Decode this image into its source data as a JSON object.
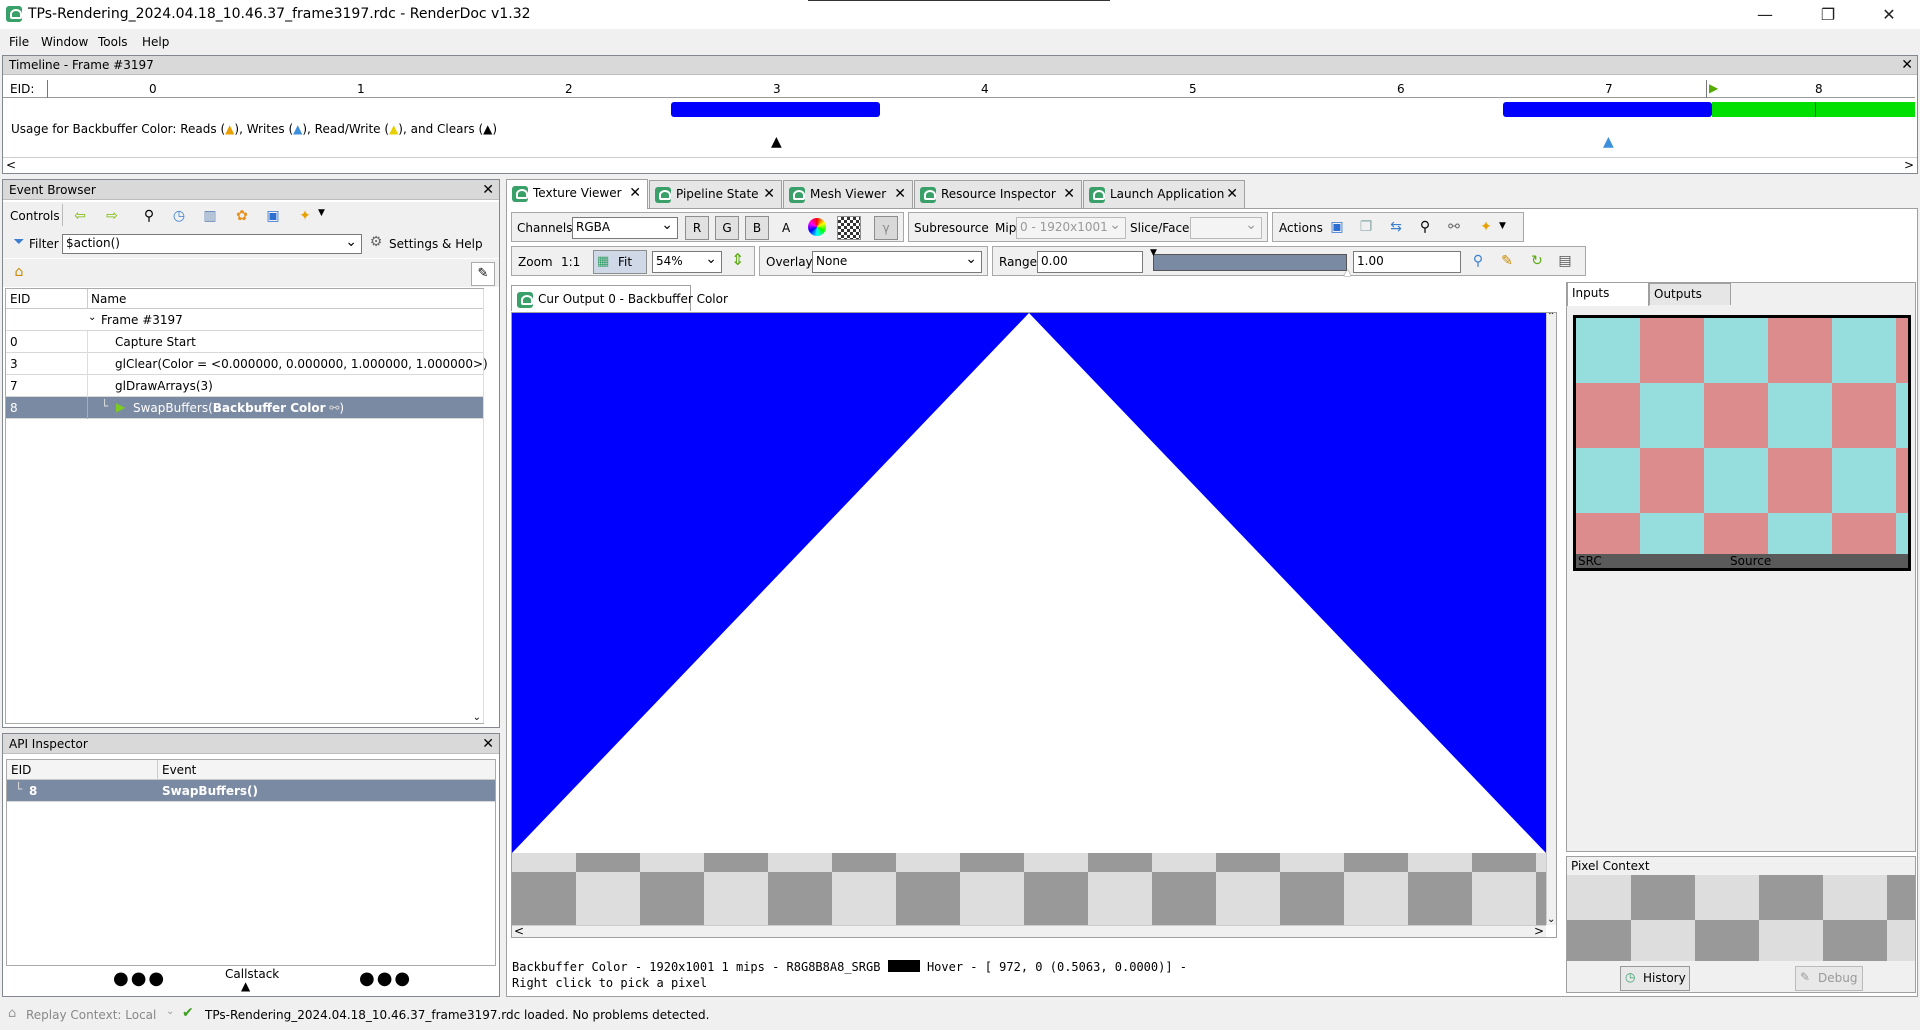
{
  "window": {
    "title": "TPs-Rendering_2024.04.18_10.46.37_frame3197.rdc - RenderDoc v1.32",
    "minimize": "—",
    "restore": "❐",
    "close": "✕"
  },
  "menu": [
    "File",
    "Window",
    "Tools",
    "Help"
  ],
  "timeline": {
    "title": "Timeline - Frame #3197",
    "eid_label": "EID:",
    "ticks": [
      "0",
      "1",
      "2",
      "3",
      "4",
      "5",
      "6",
      "7",
      "8"
    ],
    "usage_text": "Usage for Backbuffer Color: Reads (",
    "usage_writes": "), Writes (",
    "usage_rw": "), Read/Write (",
    "usage_clears": "), and Clears (",
    "usage_end": ")"
  },
  "event_browser": {
    "title": "Event Browser",
    "controls_label": "Controls",
    "filter_label": "Filter",
    "filter_value": "$action()",
    "settings_label": "Settings & Help",
    "columns": [
      "EID",
      "Name"
    ],
    "rows": [
      {
        "eid": "",
        "name": "Frame #3197"
      },
      {
        "eid": "0",
        "name": "Capture Start"
      },
      {
        "eid": "3",
        "name": "glClear(Color = <0.000000, 0.000000, 1.000000, 1.000000>)"
      },
      {
        "eid": "7",
        "name": "glDrawArrays(3)"
      },
      {
        "eid": "8",
        "name": "SwapBuffers(",
        "bold": "Backbuffer Color",
        "end": ")"
      }
    ]
  },
  "api_inspector": {
    "title": "API Inspector",
    "columns": [
      "EID",
      "Event"
    ],
    "row": {
      "eid": "8",
      "event": "SwapBuffers()"
    },
    "callstack": "Callstack"
  },
  "tabs": [
    "Texture Viewer",
    "Pipeline State",
    "Mesh Viewer",
    "Resource Inspector",
    "Launch Application"
  ],
  "texture_viewer": {
    "channels_label": "Channels",
    "channels_value": "RGBA",
    "r": "R",
    "g": "G",
    "b": "B",
    "a": "A",
    "subresource_label": "Subresource",
    "mip_label": "Mip",
    "mip_value": "0 - 1920x1001",
    "slice_label": "Slice/Face",
    "actions_label": "Actions",
    "zoom_label": "Zoom",
    "zoom_11": "1:1",
    "fit_label": "Fit",
    "zoom_value": "54%",
    "overlay_label": "Overlay",
    "overlay_value": "None",
    "range_label": "Range",
    "range_min": "0.00",
    "range_max": "1.00",
    "output_tab": "Cur Output 0 - Backbuffer Color",
    "status_line1_left": "Backbuffer Color - 1920x1001 1 mips - R8G8B8A8_SRGB",
    "status_line1_right": "Hover - [ 972,    0 (0.5063, 0.0000)] -",
    "status_line2": "Right click to pick a pixel"
  },
  "thumbs": {
    "inputs_tab": "Inputs",
    "outputs_tab": "Outputs",
    "src_label": "SRC",
    "source_label": "Source"
  },
  "pixel_context": {
    "title": "Pixel Context",
    "history": "History",
    "debug": "Debug"
  },
  "statusbar": {
    "replay": "Replay Context: Local",
    "message": "TPs-Rendering_2024.04.18_10.46.37_frame3197.rdc loaded. No problems detected."
  },
  "colors": {
    "clear_blue": "#0000ff",
    "timeline_green": "#00e000",
    "selection": "#7b8aa3"
  }
}
